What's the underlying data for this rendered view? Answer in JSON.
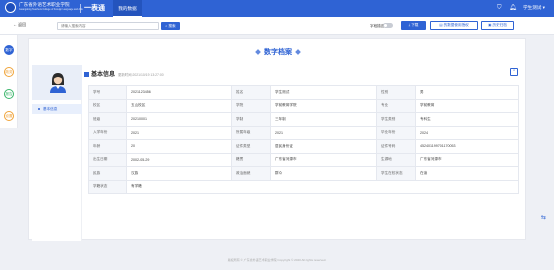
{
  "header": {
    "school_name": "广东省外语艺术职业学院",
    "school_name_en": "Guangdong Teachers College of Foreign Language and Arts",
    "brand": "一表通",
    "nav_tab": "我的数据",
    "user_name": "学生测试"
  },
  "toolbar": {
    "back_label": "← 返回",
    "search_placeholder": "请输入搜索内容",
    "search_button": "搜索",
    "toggle_label": "字段描述",
    "download_label": "下载",
    "btn_application": "的数据使用授权",
    "btn_history": "历史归档"
  },
  "left_nav": [
    "数字",
    "政务",
    "报告",
    "设置"
  ],
  "colors": {
    "accent": "#2f63d4",
    "header_bg": "#2f63d4"
  },
  "page_title": "数字档案",
  "sidebar": {
    "active_item": "基本信息"
  },
  "section": {
    "title": "基本信息",
    "update_time": "更新时间:2021/10/19 13:27:00"
  },
  "info_rows": [
    [
      {
        "k": "学号",
        "v": "2021123456"
      },
      {
        "k": "姓名",
        "v": "学生测试"
      },
      {
        "k": "性别",
        "v": "男"
      }
    ],
    [
      {
        "k": "校区",
        "v": "五山校区"
      },
      {
        "k": "学院",
        "v": "学前教育学院"
      },
      {
        "k": "专业",
        "v": "学前教育"
      }
    ],
    [
      {
        "k": "班级",
        "v": "20210001"
      },
      {
        "k": "学制",
        "v": "三年制"
      },
      {
        "k": "学生类别",
        "v": "专科生"
      }
    ],
    [
      {
        "k": "入学年份",
        "v": "2021"
      },
      {
        "k": "所属年级",
        "v": "2021"
      },
      {
        "k": "毕业年份",
        "v": "2024"
      }
    ],
    [
      {
        "k": "年龄",
        "v": "20"
      },
      {
        "k": "证件类型",
        "v": "居民身份证"
      },
      {
        "k": "证件号码",
        "v": "452401199701170053"
      }
    ],
    [
      {
        "k": "出生日期",
        "v": "2002-05-29"
      },
      {
        "k": "籍贯",
        "v": "广东省河源市"
      },
      {
        "k": "生源地",
        "v": "广东省河源市"
      }
    ],
    [
      {
        "k": "民族",
        "v": "汉族"
      },
      {
        "k": "政治面貌",
        "v": "群众"
      },
      {
        "k": "学生在校状态",
        "v": "在读"
      }
    ],
    [
      {
        "k": "学籍状态",
        "v": "有学籍"
      }
    ]
  ],
  "footer": "版权所有 © 广东省外语艺术职业学院 Copyright © 2020 All rights reserved."
}
